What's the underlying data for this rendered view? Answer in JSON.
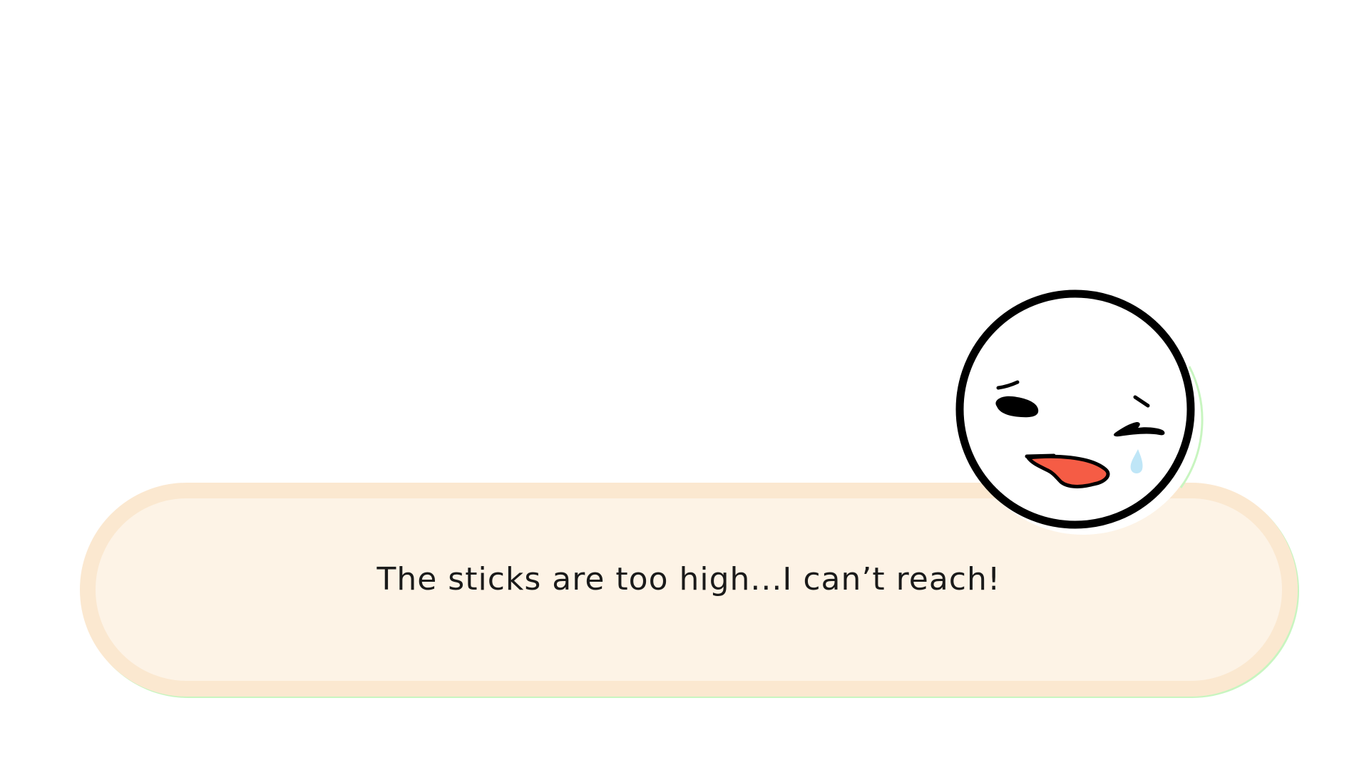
{
  "dialogue": {
    "text": "The sticks are too high...I can’t reach!"
  },
  "portrait": {
    "icon": "crying-face-icon",
    "expression": "sad-crying"
  },
  "colors": {
    "box_fill": "#fdf3e6",
    "box_border": "#fbe8d0",
    "tongue": "#f55c45",
    "tear": "#bfe6f7",
    "outline": "#000000"
  }
}
